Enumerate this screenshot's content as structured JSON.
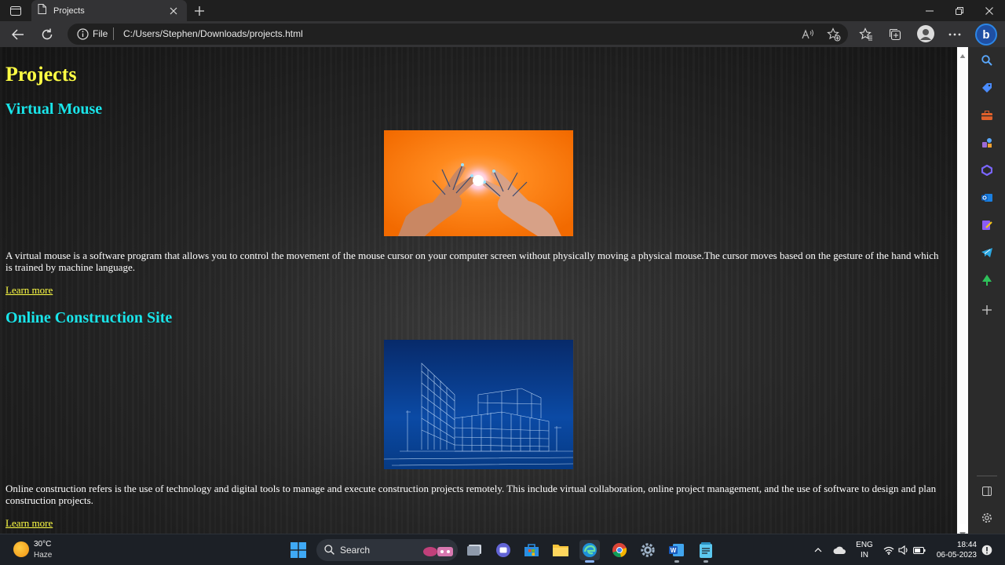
{
  "browser": {
    "tab_title": "Projects",
    "address_prefix": "File",
    "address_url": "C:/Users/Stephen/Downloads/projects.html"
  },
  "page": {
    "title": "Projects",
    "projects": [
      {
        "title": "Virtual Mouse",
        "image_alt": "hands gesture image",
        "description": "A virtual mouse is a software program that allows you to control the movement of the mouse cursor on your computer screen without physically moving a physical mouse.The cursor moves based on the gesture of the hand which is trained by machine language.",
        "link_text": "Learn more"
      },
      {
        "title": "Online Construction Site",
        "image_alt": "building wireframe image",
        "description": "Online construction refers is the use of technology and digital tools to manage and execute construction projects remotely. This include virtual collaboration, online project management, and the use of software to design and plan construction projects.",
        "link_text": "Learn more"
      }
    ]
  },
  "taskbar": {
    "weather_temp": "30°C",
    "weather_desc": "Haze",
    "search_label": "Search",
    "lang_top": "ENG",
    "lang_bottom": "IN",
    "time": "18:44",
    "date": "06-05-2023"
  },
  "colors": {
    "heading": "#ffff44",
    "project_heading": "#19e5ea",
    "body_text": "#ffffff",
    "chrome_bg": "#1f1f1f",
    "taskbar_bg": "#1c2026"
  }
}
